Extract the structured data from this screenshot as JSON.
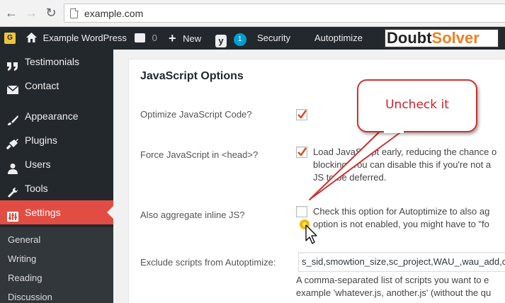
{
  "browser": {
    "url": "example.com"
  },
  "adminbar": {
    "site_name": "Example WordPress",
    "comments_count": "0",
    "new_label": "New",
    "yoast_count": "1",
    "security_label": "Security",
    "autoptimize_label": "Autoptimize",
    "logo_part1": "Doubt",
    "logo_part2": "Solver"
  },
  "sidebar": {
    "items": [
      {
        "label": "Testimonials",
        "icon": "quote-icon"
      },
      {
        "label": "Contact",
        "icon": "envelope-icon"
      },
      {
        "label": "Appearance",
        "icon": "paintbrush-icon"
      },
      {
        "label": "Plugins",
        "icon": "plug-icon"
      },
      {
        "label": "Users",
        "icon": "user-icon"
      },
      {
        "label": "Tools",
        "icon": "wrench-icon"
      },
      {
        "label": "Settings",
        "icon": "settings-icon"
      }
    ],
    "submenu": [
      "General",
      "Writing",
      "Reading",
      "Discussion"
    ]
  },
  "main": {
    "section_title": "JavaScript Options",
    "options": [
      {
        "label": "Optimize JavaScript Code?",
        "checked": true
      },
      {
        "label": "Force JavaScript in <head>?",
        "checked": true,
        "desc": [
          "Load JavaScript early, reducing the chance o",
          "blocking. You can disable this if you're not a",
          "JS to be deferred."
        ]
      },
      {
        "label": "Also aggregate inline JS?",
        "checked": false,
        "desc": [
          "Check this option for Autoptimize to also ag",
          "option is not enabled, you might have to \"fo"
        ]
      },
      {
        "label": "Exclude scripts from Autoptimize:",
        "value": "s_sid,smowtion_size,sc_project,WAU_,wau_add,c",
        "desc": [
          "A comma-separated list of scripts you want to e",
          "example 'whatever.js, another.js' (without the qu"
        ]
      }
    ]
  },
  "annotation": {
    "text": "Uncheck it",
    "color": "#d0202a"
  },
  "colors": {
    "adminbar_bg": "#23282d",
    "active_menu": "#e14d43",
    "checkmark": "#d54e21"
  }
}
